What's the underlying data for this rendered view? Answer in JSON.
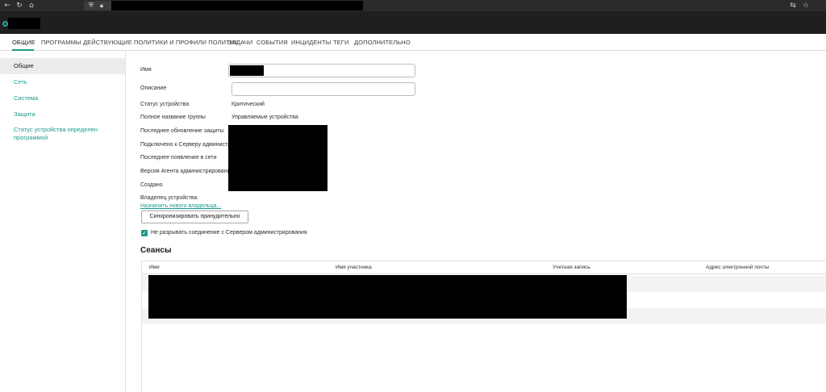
{
  "browser": {
    "back_icon": "arrow-left-icon",
    "reload_icon": "reload-icon",
    "home_icon": "home-icon",
    "shield_icon": "shield-icon",
    "lock_icon": "lock-icon",
    "translate_icon": "translate-icon",
    "star_icon": "star-icon"
  },
  "tabs": [
    {
      "label": "ОБЩИЕ"
    },
    {
      "label": "ПРОГРАММЫ"
    },
    {
      "label": "ДЕЙСТВУЮЩИЕ ПОЛИТИКИ И ПРОФИЛИ ПОЛИТИК"
    },
    {
      "label": "ЗАДАЧИ"
    },
    {
      "label": "СОБЫТИЯ"
    },
    {
      "label": "ИНЦИДЕНТЫ"
    },
    {
      "label": "ТЕГИ"
    },
    {
      "label": "ДОПОЛНИТЕЛЬНО"
    }
  ],
  "sidebar": {
    "items": [
      {
        "label": "Общие"
      },
      {
        "label": "Сеть"
      },
      {
        "label": "Система"
      },
      {
        "label": "Защита"
      },
      {
        "label": "Статус устройства определен программой"
      }
    ]
  },
  "form": {
    "name_label": "Имя",
    "description_label": "Описание",
    "status_label": "Статус устройства",
    "status_value": "Критический",
    "group_label": "Полное название группы",
    "group_value": "Управляемые устройства",
    "last_update_label": "Последнее обновление защиты",
    "connected_label": "Подключено к Серверу администрирования",
    "last_seen_label": "Последнее появление в сети",
    "agent_version_label": "Версия Агента администрирования",
    "created_label": "Создано",
    "owner_label": "Владелец устройства",
    "assign_owner_link": "Назначить нового владельца...",
    "sync_button": "Синхронизировать принудительно",
    "keep_connection_label": "Не разрывать соединение с Сервером администрирования",
    "keep_connection_checked": true
  },
  "sessions": {
    "title": "Сеансы",
    "columns": [
      "Имя",
      "Имя участника",
      "Учетная запись",
      "Адрес электронной почты"
    ]
  },
  "colors": {
    "accent": "#1b9b8a",
    "header_bg": "#1f1f1f"
  }
}
